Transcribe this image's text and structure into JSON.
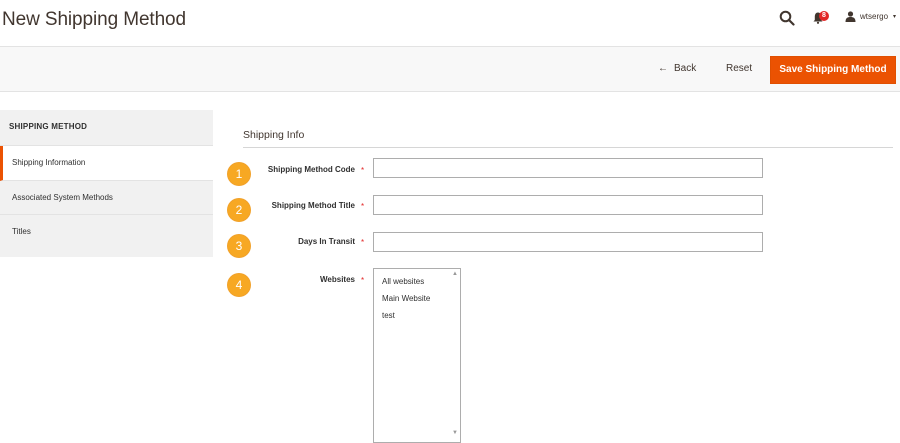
{
  "page": {
    "title": "New Shipping Method"
  },
  "header": {
    "notification_count": "8",
    "username": "wtsergo",
    "caret": "▾"
  },
  "actions": {
    "back_label": "Back",
    "back_arrow": "←",
    "reset_label": "Reset",
    "save_label": "Save Shipping Method"
  },
  "sidebar": {
    "title": "SHIPPING METHOD",
    "items": [
      {
        "label": "Shipping Information"
      },
      {
        "label": "Associated System Methods"
      },
      {
        "label": "Titles"
      }
    ]
  },
  "form": {
    "section_title": "Shipping Info",
    "required_mark": "*",
    "fields": [
      {
        "step": "1",
        "label": "Shipping Method Code",
        "value": ""
      },
      {
        "step": "2",
        "label": "Shipping Method Title",
        "value": ""
      },
      {
        "step": "3",
        "label": "Days In Transit",
        "value": ""
      },
      {
        "step": "4",
        "label": "Websites"
      }
    ],
    "websites_options": [
      "All websites",
      "Main Website",
      "test"
    ]
  },
  "colors": {
    "accent": "#eb5202",
    "badge": "#f7a823",
    "required": "#e22626"
  },
  "icons": {
    "search": "search-icon",
    "notifications": "bell-icon",
    "user": "user-icon"
  }
}
